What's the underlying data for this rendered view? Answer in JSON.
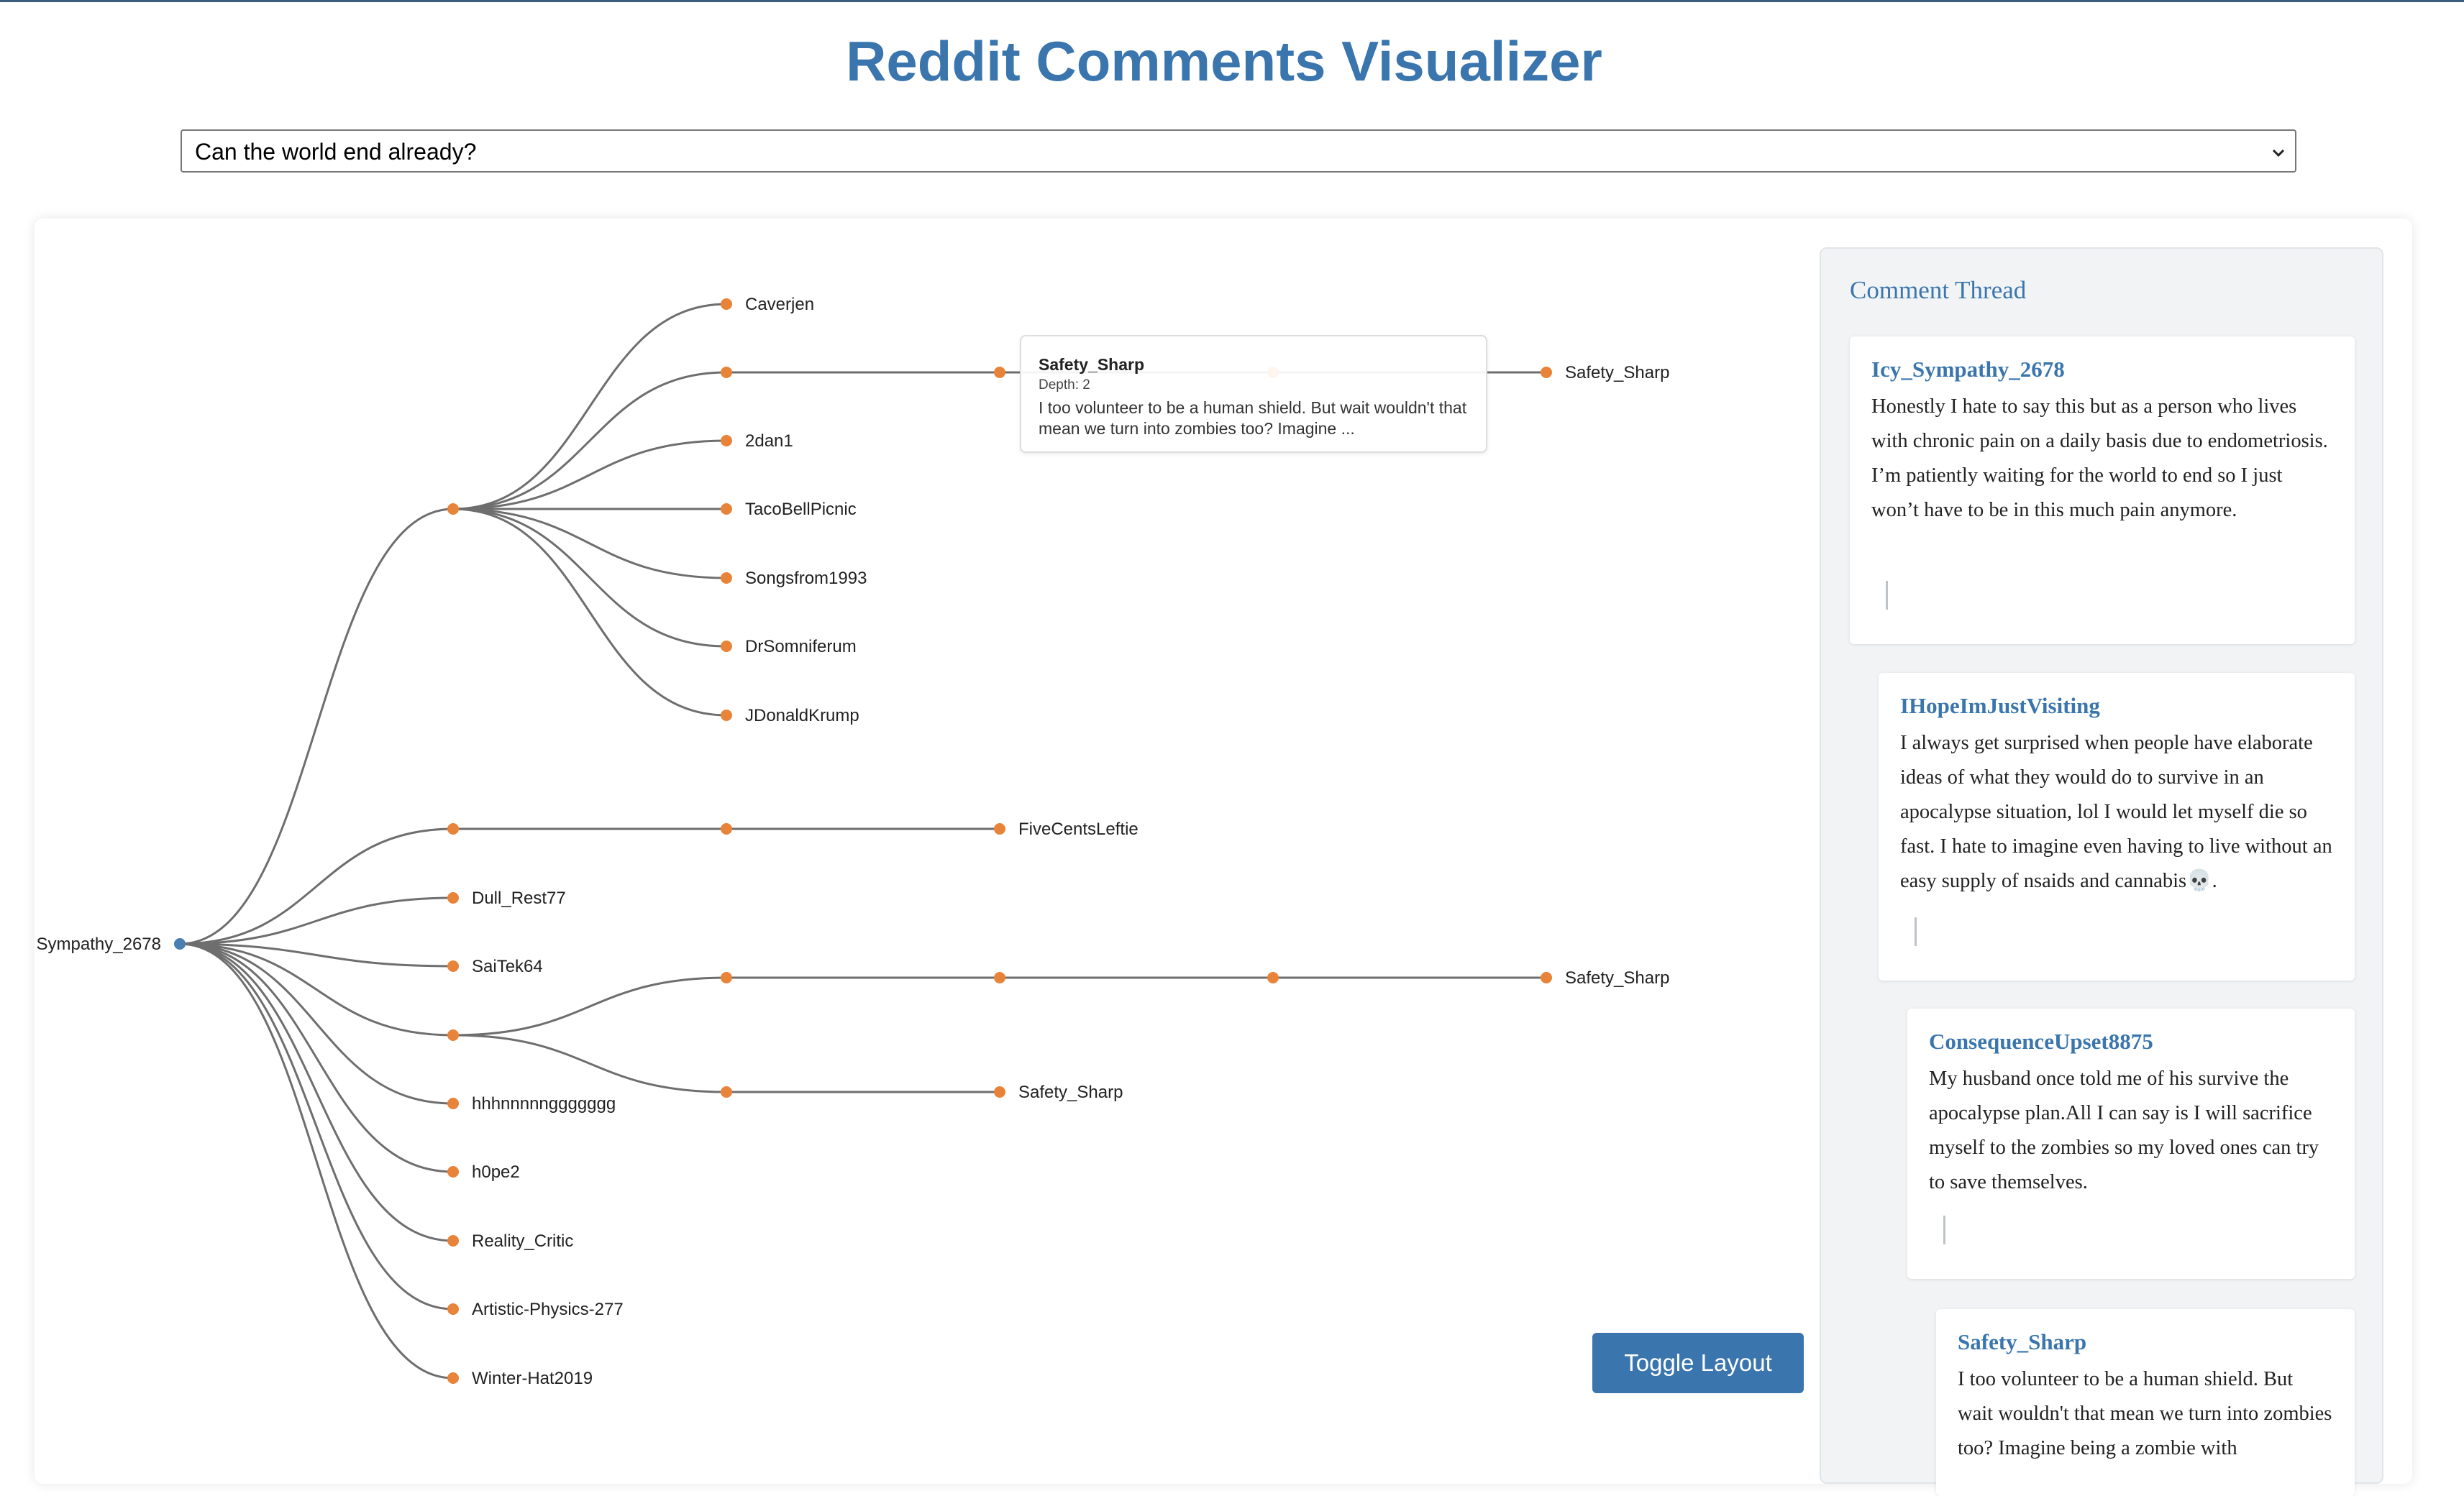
{
  "page": {
    "title": "Reddit Comments Visualizer"
  },
  "post_select": {
    "selected": "Can the world end already?"
  },
  "tree": {
    "root": {
      "label": "Sympathy_2678"
    },
    "nodes": [
      {
        "id": "n1",
        "label": ""
      },
      {
        "id": "n2",
        "label": "Caverjen"
      },
      {
        "id": "n3",
        "label": ""
      },
      {
        "id": "n4",
        "label": ""
      },
      {
        "id": "n5",
        "label": ""
      },
      {
        "id": "n6",
        "label": "Safety_Sharp"
      },
      {
        "id": "n7",
        "label": "2dan1"
      },
      {
        "id": "n8",
        "label": "TacoBellPicnic"
      },
      {
        "id": "n9",
        "label": "Songsfrom1993"
      },
      {
        "id": "n10",
        "label": "DrSomniferum"
      },
      {
        "id": "n11",
        "label": "JDonaldKrump"
      },
      {
        "id": "n12",
        "label": ""
      },
      {
        "id": "n13",
        "label": ""
      },
      {
        "id": "n14",
        "label": "FiveCentsLeftie"
      },
      {
        "id": "n15",
        "label": "Dull_Rest77"
      },
      {
        "id": "n16",
        "label": "SaiTek64"
      },
      {
        "id": "n17",
        "label": ""
      },
      {
        "id": "n18",
        "label": ""
      },
      {
        "id": "n19",
        "label": ""
      },
      {
        "id": "n20",
        "label": ""
      },
      {
        "id": "n21",
        "label": "Safety_Sharp"
      },
      {
        "id": "n22",
        "label": ""
      },
      {
        "id": "n23",
        "label": "Safety_Sharp"
      },
      {
        "id": "n24",
        "label": "hhhnnnnnggggggg"
      },
      {
        "id": "n25",
        "label": "h0pe2"
      },
      {
        "id": "n26",
        "label": "Reality_Critic"
      },
      {
        "id": "n27",
        "label": "Artistic-Physics-277"
      },
      {
        "id": "n28",
        "label": "Winter-Hat2019"
      }
    ],
    "links": [
      [
        "root",
        "n1"
      ],
      [
        "n1",
        "n2"
      ],
      [
        "n1",
        "n3"
      ],
      [
        "n3",
        "n4"
      ],
      [
        "n4",
        "n5"
      ],
      [
        "n5",
        "n6"
      ],
      [
        "n1",
        "n7"
      ],
      [
        "n1",
        "n8"
      ],
      [
        "n1",
        "n9"
      ],
      [
        "n1",
        "n10"
      ],
      [
        "n1",
        "n11"
      ],
      [
        "root",
        "n12"
      ],
      [
        "n12",
        "n13"
      ],
      [
        "n13",
        "n14"
      ],
      [
        "root",
        "n15"
      ],
      [
        "root",
        "n16"
      ],
      [
        "root",
        "n17"
      ],
      [
        "n17",
        "n18"
      ],
      [
        "n18",
        "n19"
      ],
      [
        "n19",
        "n20"
      ],
      [
        "n20",
        "n21"
      ],
      [
        "n17",
        "n22"
      ],
      [
        "n22",
        "n23"
      ],
      [
        "root",
        "n24"
      ],
      [
        "root",
        "n25"
      ],
      [
        "root",
        "n26"
      ],
      [
        "root",
        "n27"
      ],
      [
        "root",
        "n28"
      ]
    ]
  },
  "tooltip": {
    "name": "Safety_Sharp",
    "depth": "Depth: 2",
    "text": "I too volunteer to be a human shield. But wait wouldn't that mean we turn into zombies too? Imagine ..."
  },
  "toggle_button": {
    "label": "Toggle Layout"
  },
  "thread": {
    "title": "Comment Thread",
    "comments": [
      {
        "author": "Icy_Sympathy_2678",
        "text": "Honestly I hate to say this but as a person who lives with chronic pain on a daily basis due to endometriosis. I’m patiently waiting for the world to end so I just won’t have to be in this much pain anymore."
      },
      {
        "author": "IHopeImJustVisiting",
        "text": "I always get surprised when people have elaborate ideas of what they would do to survive in an apocalypse situation, lol I would let myself die so fast. I hate to imagine even having to live without an easy supply of nsaids and cannabis💀."
      },
      {
        "author": "ConsequenceUpset8875",
        "text": "My husband once told me of his survive the apocalypse plan.All I can say is I will sacrifice myself to the zombies so my loved ones can try to save themselves."
      },
      {
        "author": "Safety_Sharp",
        "text": "I too volunteer to be a human shield. But wait wouldn't that mean we turn into zombies too? Imagine being a zombie with"
      }
    ]
  }
}
